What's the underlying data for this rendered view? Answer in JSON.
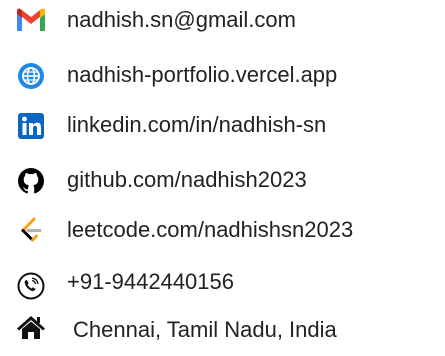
{
  "contacts": {
    "items": [
      {
        "icon": "gmail-icon",
        "text": "nadhish.sn@gmail.com"
      },
      {
        "icon": "globe-icon",
        "text": "nadhish-portfolio.vercel.app"
      },
      {
        "icon": "linkedin-icon",
        "text": "linkedin.com/in/nadhish-sn"
      },
      {
        "icon": "github-icon",
        "text": "github.com/nadhish2023"
      },
      {
        "icon": "leetcode-icon",
        "text": "leetcode.com/nadhishsn2023"
      },
      {
        "icon": "phone-icon",
        "text": "+91-9442440156"
      },
      {
        "icon": "home-icon",
        "text": "Chennai, Tamil Nadu, India"
      }
    ]
  },
  "colors": {
    "text": "#222222",
    "gmail_red": "#EA4335",
    "gmail_blue": "#4285F4",
    "globe_blue": "#1E88E5",
    "linkedin_blue": "#0A66C2",
    "github_black": "#000000",
    "leetcode_orange": "#FFA116",
    "leetcode_gray": "#B3B3B3"
  }
}
